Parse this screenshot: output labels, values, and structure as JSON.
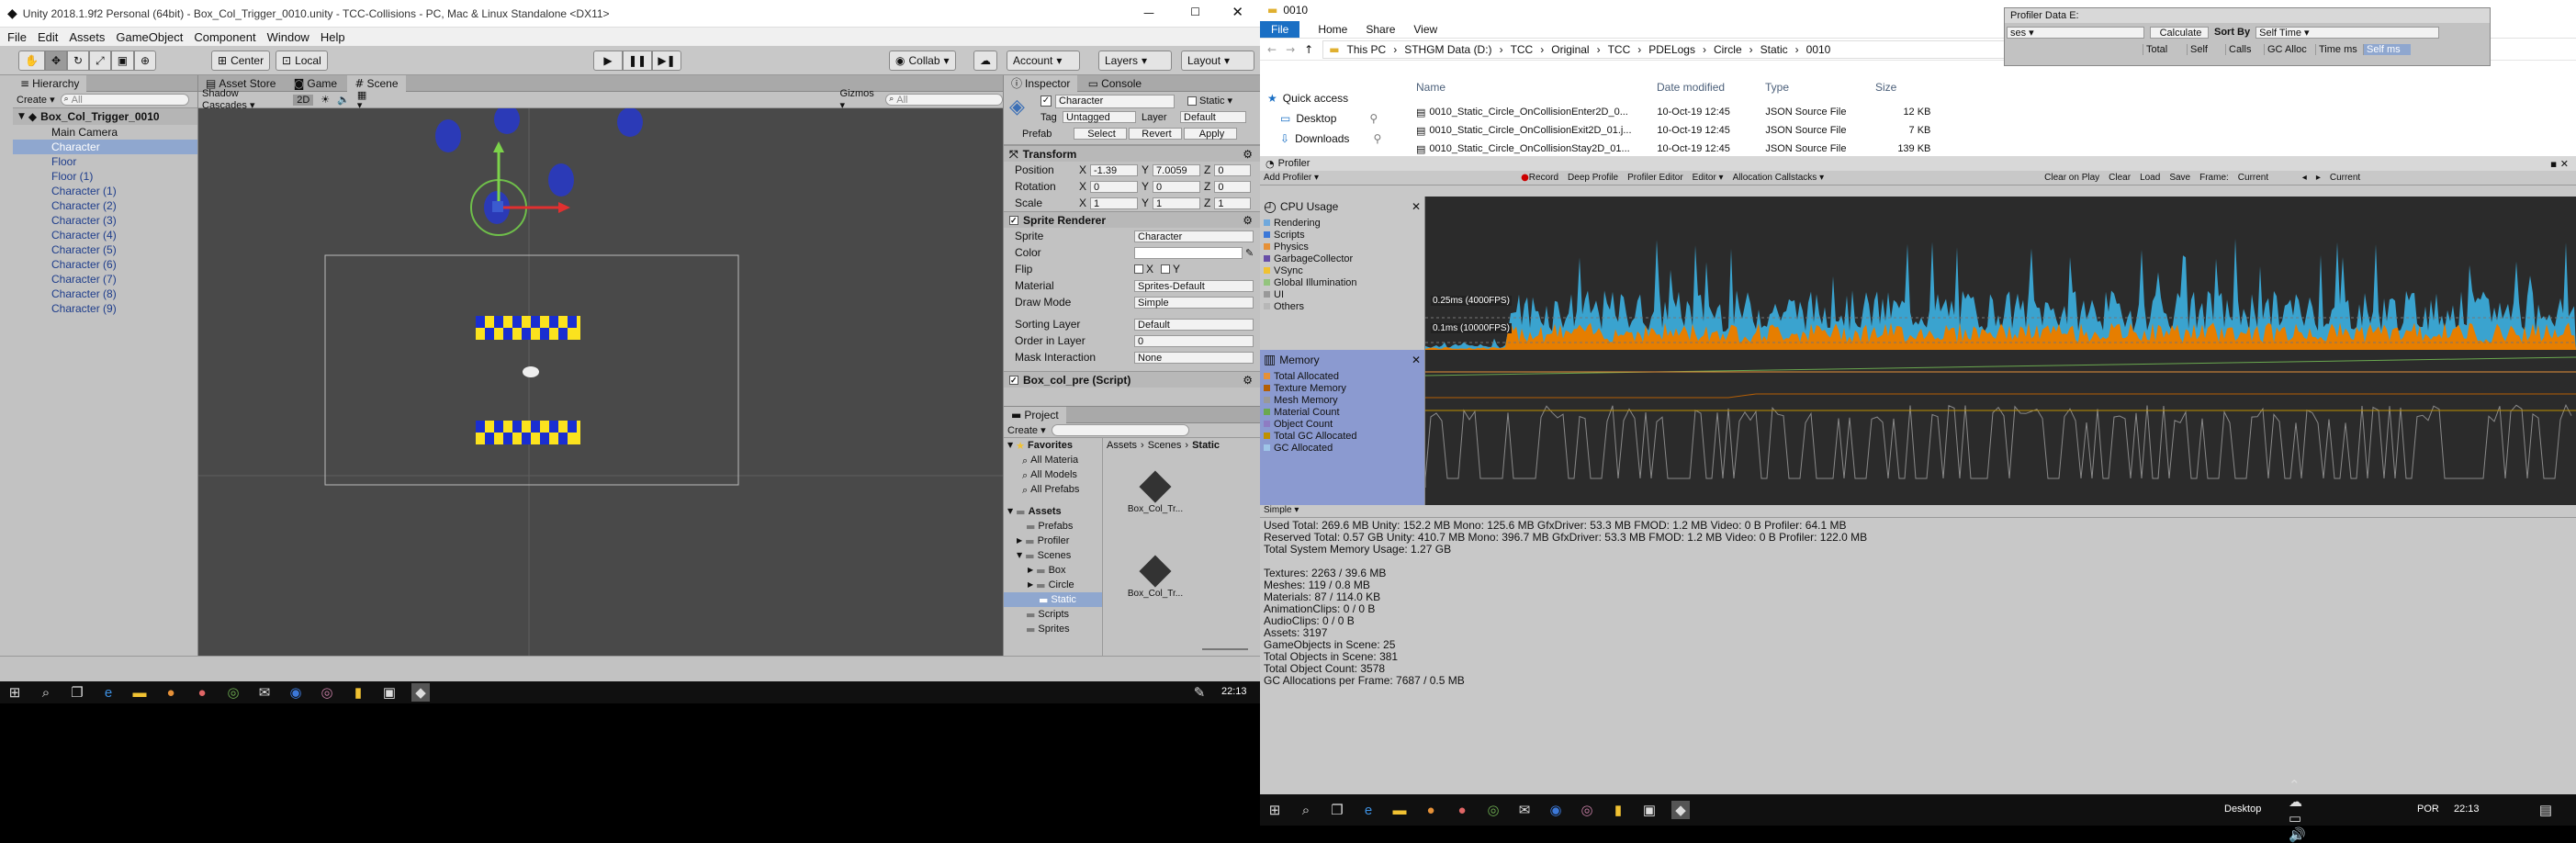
{
  "unity": {
    "title": "Unity 2018.1.9f2 Personal (64bit) - Box_Col_Trigger_0010.unity - TCC-Collisions - PC, Mac & Linux Standalone <DX11>",
    "menu": [
      "File",
      "Edit",
      "Assets",
      "GameObject",
      "Component",
      "Window",
      "Help"
    ],
    "toolbar": {
      "pivot": "Center",
      "space": "Local",
      "collab": "Collab",
      "account": "Account",
      "layers": "Layers",
      "layout": "Layout"
    },
    "hierarchy": {
      "tab": "Hierarchy",
      "create": "Create",
      "search_placeholder": "All",
      "root": "Box_Col_Trigger_0010",
      "items": [
        "Main Camera",
        "Character",
        "Floor",
        "Floor (1)",
        "Character (1)",
        "Character (2)",
        "Character (3)",
        "Character (4)",
        "Character (5)",
        "Character (6)",
        "Character (7)",
        "Character (8)",
        "Character (9)"
      ],
      "selected": "Character"
    },
    "scene": {
      "tabs": [
        "Asset Store",
        "Game",
        "Scene"
      ],
      "shading": "Shadow Cascades",
      "mode2d": "2D",
      "gizmos": "Gizmos",
      "search_placeholder": "All"
    },
    "inspector": {
      "tabs": [
        "Inspector",
        "Console"
      ],
      "name": "Character",
      "static": "Static",
      "tag_label": "Tag",
      "tag": "Untagged",
      "layer_label": "Layer",
      "layer": "Default",
      "prefab": "Prefab",
      "select": "Select",
      "revert": "Revert",
      "apply": "Apply",
      "transform": "Transform",
      "position": {
        "label": "Position",
        "x": "-1.39",
        "y": "7.0059",
        "z": "0"
      },
      "rotation": {
        "label": "Rotation",
        "x": "0",
        "y": "0",
        "z": "0"
      },
      "scale": {
        "label": "Scale",
        "x": "1",
        "y": "1",
        "z": "1"
      },
      "sprite_renderer": "Sprite Renderer",
      "sprite": {
        "label": "Sprite",
        "value": "Character"
      },
      "color_label": "Color",
      "flip": {
        "label": "Flip",
        "x": "X",
        "y": "Y"
      },
      "material": {
        "label": "Material",
        "value": "Sprites-Default"
      },
      "draw_mode": {
        "label": "Draw Mode",
        "value": "Simple"
      },
      "sorting_layer": {
        "label": "Sorting Layer",
        "value": "Default"
      },
      "order_in_layer": {
        "label": "Order in Layer",
        "value": "0"
      },
      "mask_interaction": {
        "label": "Mask Interaction",
        "value": "None"
      },
      "script": "Box_col_pre (Script)"
    },
    "project": {
      "tab": "Project",
      "create": "Create",
      "favorites": "Favorites",
      "fav_items": [
        "All Materia",
        "All Models",
        "All Prefabs"
      ],
      "assets": "Assets",
      "tree": [
        "Prefabs",
        "Profiler",
        "Scenes",
        "Box",
        "Circle",
        "Static",
        "Scripts",
        "Sprites"
      ],
      "breadcrumb": [
        "Assets",
        "Scenes",
        "Static"
      ],
      "files": [
        "Box_Col_Tr...",
        "Box_Col_Tr..."
      ]
    },
    "taskbar_time": "22:13"
  },
  "explorer": {
    "title": "0010",
    "ribbon": [
      "File",
      "Home",
      "Share",
      "View"
    ],
    "path": [
      "This PC",
      "STHGM Data (D:)",
      "TCC",
      "Original",
      "TCC",
      "PDELogs",
      "Circle",
      "Static",
      "0010"
    ],
    "quick_access": "Quick access",
    "nav": [
      "Desktop",
      "Downloads"
    ],
    "columns": [
      "Name",
      "Date modified",
      "Type",
      "Size"
    ],
    "files": [
      {
        "name": "0010_Static_Circle_OnCollisionEnter2D_0...",
        "date": "10-Oct-19 12:45",
        "type": "JSON Source File",
        "size": "12 KB"
      },
      {
        "name": "0010_Static_Circle_OnCollisionExit2D_01.j...",
        "date": "10-Oct-19 12:45",
        "type": "JSON Source File",
        "size": "7 KB"
      },
      {
        "name": "0010_Static_Circle_OnCollisionStay2D_01...",
        "date": "10-Oct-19 12:45",
        "type": "JSON Source File",
        "size": "139 KB"
      }
    ]
  },
  "profiler_data": {
    "title": "Profiler Data E:",
    "dropdown": "ses",
    "calculate": "Calculate",
    "sort_by": "Sort By",
    "sort_value": "Self Time",
    "columns": [
      "Total",
      "Self",
      "Calls",
      "GC Alloc",
      "Time ms",
      "Self ms"
    ]
  },
  "profiler": {
    "tab": "Profiler",
    "add_profiler": "Add Profiler",
    "toolbar": [
      "Record",
      "Deep Profile",
      "Profiler Editor",
      "Editor",
      "Allocation Callstacks"
    ],
    "toolbar_right": [
      "Clear on Play",
      "Clear",
      "Load",
      "Save"
    ],
    "frame_label": "Frame:",
    "frame_value": "Current",
    "current_btn": "Current",
    "cpu_title": "CPU Usage",
    "cpu_legend": [
      {
        "name": "Rendering",
        "color": "#6fa8dc"
      },
      {
        "name": "Scripts",
        "color": "#3c78d8"
      },
      {
        "name": "Physics",
        "color": "#e69138"
      },
      {
        "name": "GarbageCollector",
        "color": "#674ea7"
      },
      {
        "name": "VSync",
        "color": "#f1c232"
      },
      {
        "name": "Global Illumination",
        "color": "#93c47d"
      },
      {
        "name": "UI",
        "color": "#999999"
      },
      {
        "name": "Others",
        "color": "#b7b7b7"
      }
    ],
    "cpu_marker_high": "0.25ms (4000FPS)",
    "cpu_marker_low": "0.1ms (10000FPS)",
    "mem_title": "Memory",
    "mem_legend": [
      {
        "name": "Total Allocated",
        "color": "#e69138"
      },
      {
        "name": "Texture Memory",
        "color": "#b45f06"
      },
      {
        "name": "Mesh Memory",
        "color": "#999999"
      },
      {
        "name": "Material Count",
        "color": "#6aa84f"
      },
      {
        "name": "Object Count",
        "color": "#8e7cc3"
      },
      {
        "name": "Total GC Allocated",
        "color": "#bf9000"
      },
      {
        "name": "GC Allocated",
        "color": "#9fc5e8"
      }
    ],
    "view_mode": "Simple",
    "stats": [
      "Used Total: 269.6 MB   Unity: 152.2 MB   Mono: 125.6 MB   GfxDriver: 53.3 MB   FMOD: 1.2 MB   Video: 0 B   Profiler: 64.1 MB",
      "Reserved Total: 0.57 GB   Unity: 410.7 MB   Mono: 396.7 MB   GfxDriver: 53.3 MB   FMOD: 1.2 MB   Video: 0 B   Profiler: 122.0 MB",
      "Total System Memory Usage: 1.27 GB",
      "",
      "Textures: 2263 / 39.6 MB",
      "Meshes: 119 / 0.8 MB",
      "Materials: 87 / 114.0 KB",
      "AnimationClips: 0 / 0 B",
      "AudioClips: 0 / 0 B",
      "Assets: 3197",
      "GameObjects in Scene: 25",
      "Total Objects in Scene: 381",
      "Total Object Count: 3578",
      "GC Allocations per Frame: 7687 / 0.5 MB"
    ]
  },
  "taskbar2": {
    "desktop": "Desktop",
    "lang": "POR",
    "time": "22:13"
  }
}
